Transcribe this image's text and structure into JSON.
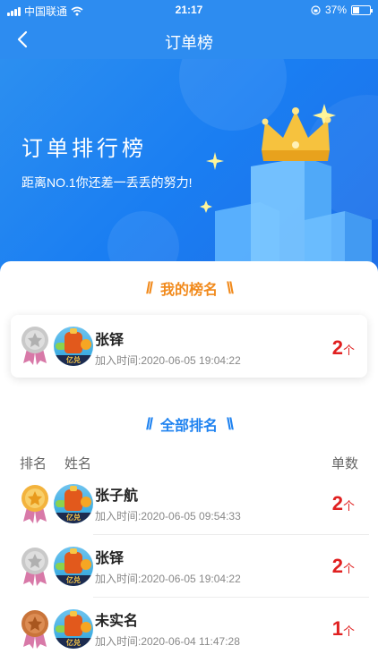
{
  "status_bar": {
    "carrier": "中国联通",
    "time": "21:17",
    "battery": "37%"
  },
  "nav": {
    "title": "订单榜"
  },
  "hero": {
    "title": "订单排行榜",
    "subtitle": "距离NO.1你还差一丢丢的努力!"
  },
  "my_rank": {
    "heading": "我的榜名",
    "name": "张铎",
    "joined": "加入时间:2020-06-05 19:04:22",
    "count": "2",
    "unit": "个",
    "medal": "silver"
  },
  "all_rank": {
    "heading": "全部排名",
    "columns": {
      "rank": "排名",
      "name": "姓名",
      "count": "单数"
    },
    "rows": [
      {
        "name": "张子航",
        "joined": "加入时间:2020-06-05 09:54:33",
        "count": "2",
        "unit": "个",
        "medal": "gold"
      },
      {
        "name": "张铎",
        "joined": "加入时间:2020-06-05 19:04:22",
        "count": "2",
        "unit": "个",
        "medal": "silver"
      },
      {
        "name": "未实名",
        "joined": "加入时间:2020-06-04 11:47:28",
        "count": "1",
        "unit": "个",
        "medal": "bronze"
      }
    ]
  },
  "avatar_brand": "亿兑",
  "colors": {
    "primary": "#2d8cf0",
    "my_rank_accent": "#f18a1c",
    "all_rank_accent": "#1e82f0",
    "count_red": "#e02020",
    "medal_gold": "#f3b33d",
    "medal_silver": "#b7b7b7",
    "medal_bronze": "#c9743a",
    "ribbon_pink": "#d879a8"
  }
}
